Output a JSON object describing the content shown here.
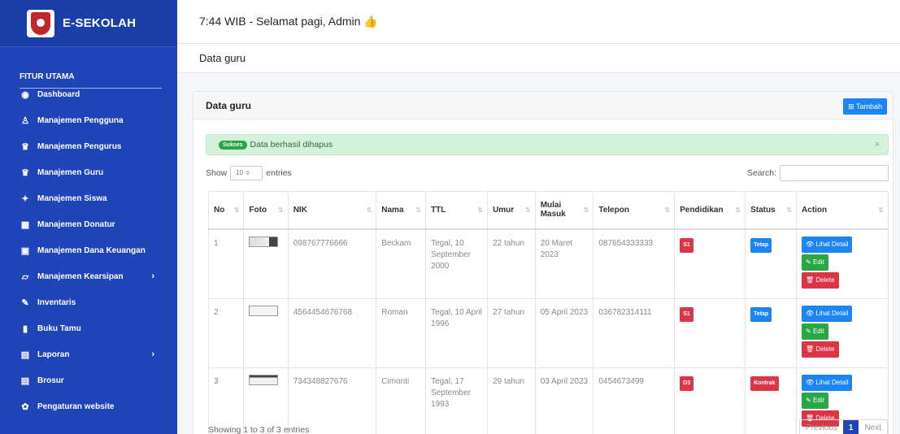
{
  "brand": {
    "name": "E-SEKOLAH",
    "logo_icon": "school-crest-icon"
  },
  "sidebar": {
    "section_title": "FITUR UTAMA",
    "items": [
      {
        "label": "Dashboard",
        "icon": "dashboard-icon",
        "glyph": "◉"
      },
      {
        "label": "Manajemen Pengguna",
        "icon": "user-icon",
        "glyph": "♙"
      },
      {
        "label": "Manajemen Pengurus",
        "icon": "users-icon",
        "glyph": "♛"
      },
      {
        "label": "Manajemen Guru",
        "icon": "users-icon",
        "glyph": "♛"
      },
      {
        "label": "Manajemen Siswa",
        "icon": "student-icon",
        "glyph": "✦"
      },
      {
        "label": "Manajemen Donatur",
        "icon": "table-icon",
        "glyph": "▦"
      },
      {
        "label": "Manajemen Dana Keuangan",
        "icon": "money-icon",
        "glyph": "▣"
      },
      {
        "label": "Manajemen Kearsipan",
        "icon": "folder-icon",
        "glyph": "▱",
        "chevron": "›"
      },
      {
        "label": "Inventaris",
        "icon": "edit-icon",
        "glyph": "✎"
      },
      {
        "label": "Buku Tamu",
        "icon": "book-icon",
        "glyph": "▮"
      },
      {
        "label": "Laporan",
        "icon": "report-icon",
        "glyph": "▤",
        "chevron": "›"
      },
      {
        "label": "Brosur",
        "icon": "brochure-icon",
        "glyph": "▤"
      },
      {
        "label": "Pengaturan website",
        "icon": "gear-icon",
        "glyph": "✿"
      }
    ]
  },
  "topbar": {
    "greeting": "7:44 WIB - Selamat pagi, Admin 👍"
  },
  "subbar": {
    "title": "Data guru"
  },
  "card": {
    "title": "Data guru",
    "add_button": "⊞ Tambah"
  },
  "alert": {
    "badge": "Sukses",
    "message": "Data berhasil dihapus",
    "close": "×"
  },
  "controls": {
    "show_label": "Show",
    "entries_value": "10",
    "entries_label": "entries",
    "search_label": "Search:"
  },
  "table": {
    "columns": [
      "No",
      "Foto",
      "NIK",
      "Nama",
      "TTL",
      "Umur",
      "Mulai Masuk",
      "Telepon",
      "Pendidikan",
      "Status",
      "Action"
    ],
    "rows": [
      {
        "no": "1",
        "nik": "098767776666",
        "nama": "Beckam",
        "ttl": "Tegal, 10 September 2000",
        "umur": "22 tahun",
        "mulai": "20 Maret 2023",
        "telepon": "087654333333",
        "pendidikan": "S1",
        "status": "Tetap"
      },
      {
        "no": "2",
        "nik": "4564454676768",
        "nama": "Roman",
        "ttl": "Tegal, 10 April 1996",
        "umur": "27 tahun",
        "mulai": "05 April 2023",
        "telepon": "036782314111",
        "pendidikan": "S1",
        "status": "Tetap"
      },
      {
        "no": "3",
        "nik": "734348827676",
        "nama": "Cimonti",
        "ttl": "Tegal, 17 September 1993",
        "umur": "29 tahun",
        "mulai": "03 April 2023",
        "telepon": "0454673499",
        "pendidikan": "D3",
        "status": "Kontrak"
      }
    ],
    "actions": {
      "detail": "👁 Lihat Detail",
      "edit": "✎ Edit",
      "delete": "🗑 Delete"
    }
  },
  "footer": {
    "info": "Showing 1 to 3 of 3 entries",
    "prev": "Previous",
    "page": "1",
    "next": "Next"
  },
  "colors": {
    "sidebar": "#1f45b8",
    "primary": "#1c84f3",
    "success": "#28a745",
    "danger": "#dc3545"
  }
}
